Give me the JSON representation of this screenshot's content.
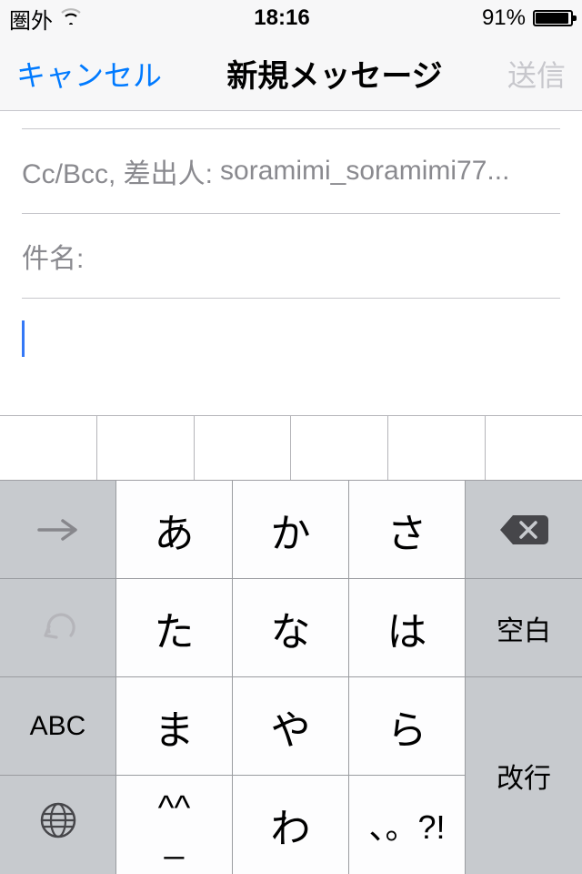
{
  "status": {
    "carrier": "圏外",
    "time": "18:16",
    "battery_pct": "91%"
  },
  "nav": {
    "cancel": "キャンセル",
    "title": "新規メッセージ",
    "send": "送信"
  },
  "compose": {
    "cc_label": "Cc/Bcc, 差出人:",
    "cc_value": "soramimi_soramimi77...",
    "subject_label": "件名:"
  },
  "keyboard": {
    "rows": [
      {
        "arrow": "→",
        "a": "あ",
        "ka": "か",
        "sa": "さ"
      },
      {
        "ta": "た",
        "na": "な",
        "ha": "は",
        "space": "空白"
      },
      {
        "abc": "ABC",
        "ma": "ま",
        "ya": "や",
        "ra": "ら",
        "ret": "改行"
      },
      {
        "face_top": "^^",
        "face_bot": "_",
        "wa": "わ",
        "punct": "、。?!"
      }
    ]
  }
}
